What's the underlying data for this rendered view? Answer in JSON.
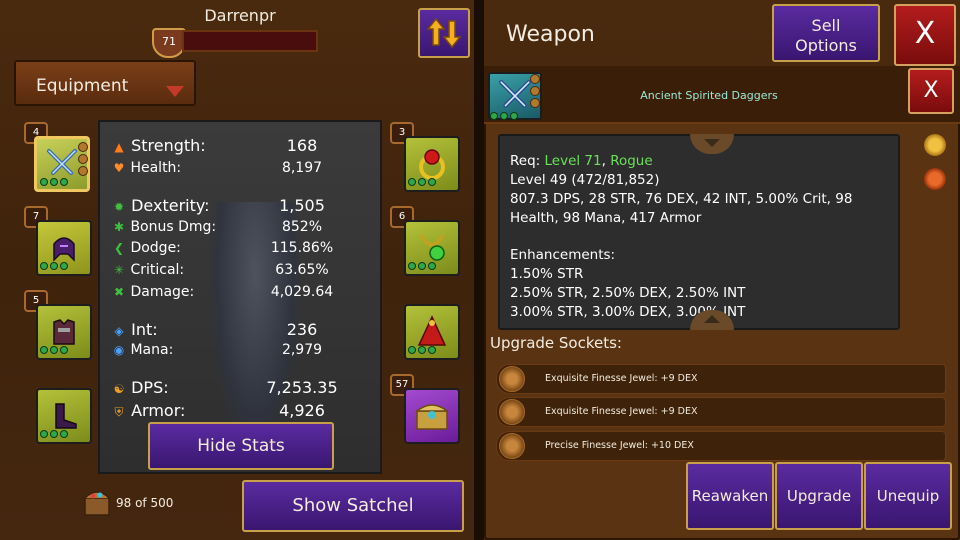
{
  "player": {
    "name": "Darrenpr",
    "level": "71"
  },
  "equipment_dropdown": {
    "label": "Equipment"
  },
  "slots_left": [
    {
      "badge": "4",
      "item": "daggers-icon"
    },
    {
      "badge": "7",
      "item": "helmet-icon"
    },
    {
      "badge": "5",
      "item": "chest-armor-icon"
    },
    {
      "badge": "",
      "item": "boots-icon"
    }
  ],
  "slots_right": [
    {
      "badge": "3",
      "item": "ring-icon"
    },
    {
      "badge": "6",
      "item": "amulet-icon"
    },
    {
      "badge": "",
      "item": "cape-icon"
    },
    {
      "badge": "57",
      "item": "chest-icon"
    }
  ],
  "stats": {
    "strength": {
      "label": "Strength:",
      "value": "168"
    },
    "health": {
      "label": "Health:",
      "value": "8,197"
    },
    "dexterity": {
      "label": "Dexterity:",
      "value": "1,505"
    },
    "bonus_dmg": {
      "label": "Bonus Dmg:",
      "value": "852%"
    },
    "dodge": {
      "label": "Dodge:",
      "value": "115.86%"
    },
    "critical": {
      "label": "Critical:",
      "value": "63.65%"
    },
    "damage": {
      "label": "Damage:",
      "value": "4,029.64"
    },
    "int": {
      "label": "Int:",
      "value": "236"
    },
    "mana": {
      "label": "Mana:",
      "value": "2,979"
    },
    "dps": {
      "label": "DPS:",
      "value": "7,253.35"
    },
    "armor": {
      "label": "Armor:",
      "value": "4,926"
    }
  },
  "hide_stats_label": "Hide Stats",
  "satchel": {
    "count": "98 of 500",
    "button": "Show Satchel"
  },
  "weapon_panel": {
    "title": "Weapon",
    "sell_line1": "Sell",
    "sell_line2": "Options",
    "close": "X",
    "item_name": "Ancient Spirited Daggers",
    "item_close": "X",
    "req_label": "Req:",
    "req_level": "Level 71",
    "req_sep": ",",
    "req_class": "Rogue",
    "line_level": "Level 49 (472/81,852)",
    "line_stats1": "807.3 DPS, 28 STR, 76 DEX, 42 INT, 5.00% Crit, 98",
    "line_stats2": "Health, 98 Mana, 417 Armor",
    "enh_title": "Enhancements:",
    "enh1": "1.50% STR",
    "enh2": "2.50% STR, 2.50% DEX, 2.50% INT",
    "enh3": "3.00% STR, 3.00% DEX, 3.00% INT",
    "upgrade_sockets_title": "Upgrade Sockets:",
    "sockets": [
      "Exquisite Finesse Jewel: +9 DEX",
      "Exquisite Finesse Jewel: +9 DEX",
      "Precise Finesse Jewel: +10 DEX"
    ],
    "buttons": {
      "reawaken": "Reawaken",
      "upgrade": "Upgrade",
      "unequip": "Unequip"
    }
  },
  "colors": {
    "panel_brown": "#4a2a0f",
    "button_purple": "#5a2ba0",
    "button_red": "#b41c1c",
    "req_green": "#6be05a",
    "item_name_teal": "#9ce8d8"
  }
}
